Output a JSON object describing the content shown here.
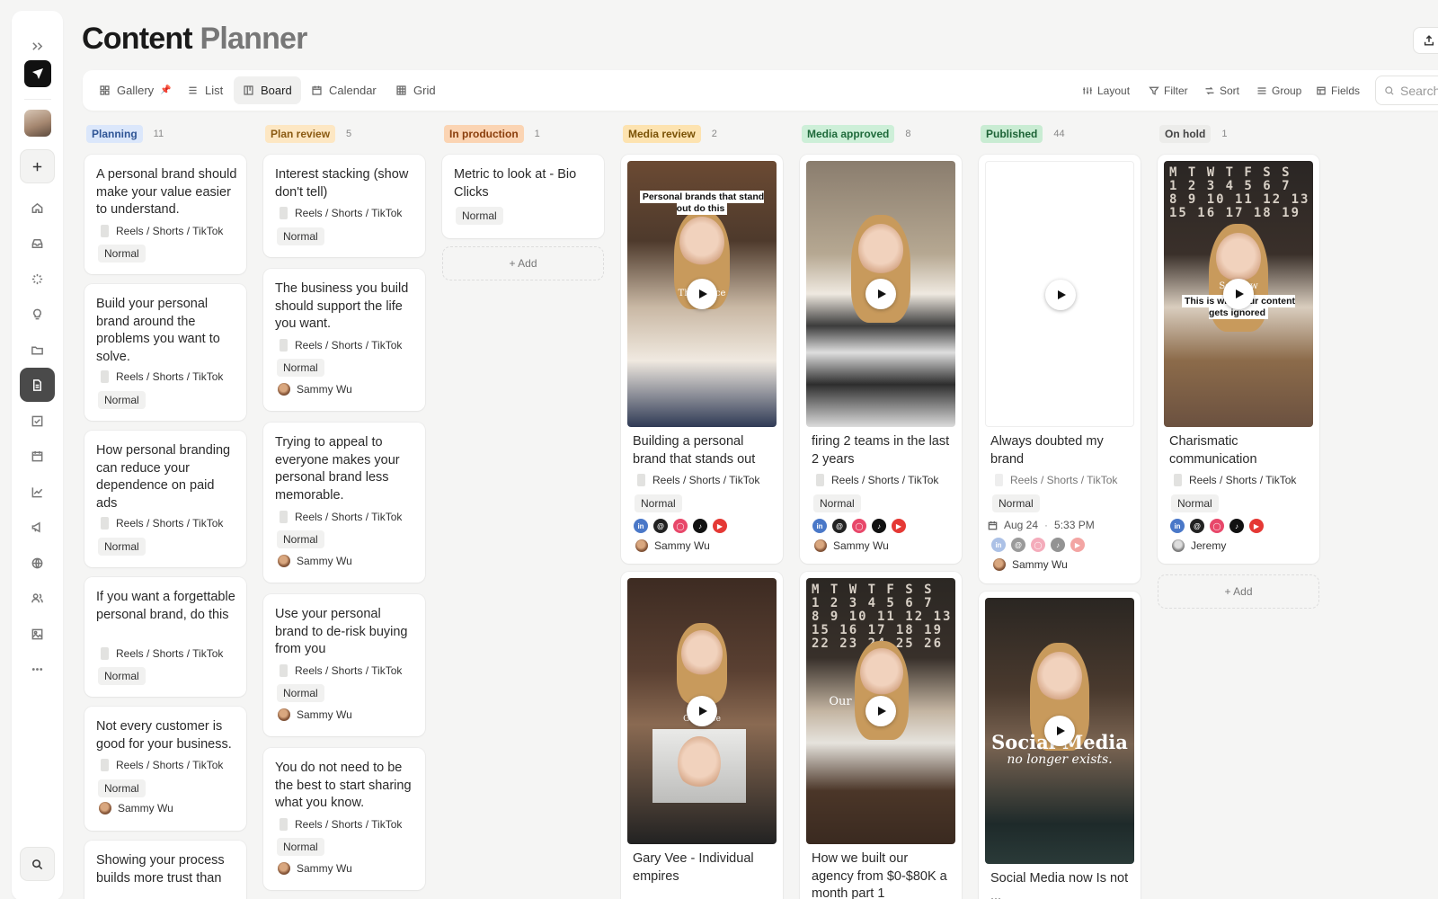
{
  "header": {
    "title_bold": "Content",
    "title_light": "Planner"
  },
  "views": [
    {
      "label": "Gallery",
      "icon": "gallery-icon",
      "pinned": true
    },
    {
      "label": "List",
      "icon": "list-icon"
    },
    {
      "label": "Board",
      "icon": "board-icon",
      "active": true
    },
    {
      "label": "Calendar",
      "icon": "calendar-icon"
    },
    {
      "label": "Grid",
      "icon": "grid-icon"
    }
  ],
  "tools": {
    "layout": "Layout",
    "filter": "Filter",
    "sort": "Sort",
    "group": "Group",
    "fields": "Fields",
    "search_placeholder": "Search"
  },
  "columns": [
    {
      "status": "Planning",
      "count": "11",
      "bg": "#dbe7fb",
      "fg": "#2f5596",
      "cards": [
        {
          "title": "A personal brand should make your value easier to understand.",
          "format": "Reels / Shorts / TikTok",
          "priority": "Normal"
        },
        {
          "title": "Build your personal brand around the problems you want to solve.",
          "format": "Reels / Shorts / TikTok",
          "priority": "Normal"
        },
        {
          "title": "How personal branding can reduce your dependence on paid ads",
          "format": "Reels / Shorts / TikTok",
          "priority": "Normal"
        },
        {
          "title": "If you want a forgettable personal brand, do this",
          "format": "Reels / Shorts / TikTok",
          "priority": "Normal"
        },
        {
          "title": "Not every customer is good for your business.",
          "format": "Reels / Shorts / TikTok",
          "priority": "Normal",
          "assignee": "Sammy Wu"
        },
        {
          "title": "Showing your process builds more trust than"
        }
      ]
    },
    {
      "status": "Plan review",
      "count": "5",
      "bg": "#fde7c3",
      "fg": "#8a5a12",
      "cards": [
        {
          "title": "Interest stacking (show don't tell)",
          "format": "Reels / Shorts / TikTok",
          "priority": "Normal"
        },
        {
          "title": "The business you build should support the life you want.",
          "format": "Reels / Shorts / TikTok",
          "priority": "Normal",
          "assignee": "Sammy Wu"
        },
        {
          "title": "Trying to appeal to everyone makes your personal brand less memorable.",
          "format": "Reels / Shorts / TikTok",
          "priority": "Normal",
          "assignee": "Sammy Wu"
        },
        {
          "title": "Use your personal brand to de-risk buying from you",
          "format": "Reels / Shorts / TikTok",
          "priority": "Normal",
          "assignee": "Sammy Wu"
        },
        {
          "title": "You do not need to be the best to start sharing what you know.",
          "format": "Reels / Shorts / TikTok",
          "priority": "Normal",
          "assignee": "Sammy Wu"
        }
      ]
    },
    {
      "status": "In production",
      "count": "1",
      "bg": "#fbd4b3",
      "fg": "#8a3e0c",
      "cards": [
        {
          "title": "Metric to look at - Bio Clicks",
          "priority": "Normal"
        }
      ],
      "add_label": "+ Add"
    },
    {
      "status": "Media review",
      "count": "2",
      "bg": "#fde3b0",
      "fg": "#7a5206",
      "cards": [
        {
          "title": "Building a personal brand that stands out",
          "format": "Reels / Shorts / TikTok",
          "priority": "Normal",
          "assignee": "Sammy Wu",
          "caption": "Personal brands that stand out do this",
          "overlay": "The ... nce"
        },
        {
          "title": "Gary Vee - Individual empires",
          "overlay": "Gar ... ee"
        }
      ]
    },
    {
      "status": "Media approved",
      "count": "8",
      "bg": "#cdefd8",
      "fg": "#1f6a3b",
      "cards": [
        {
          "title": "firing 2 teams in the last 2 years",
          "format": "Reels / Shorts / TikTok",
          "priority": "Normal",
          "assignee": "Sammy Wu"
        },
        {
          "title": "How we built our agency from $0-$80K a month part 1",
          "overlay": "Our"
        }
      ]
    },
    {
      "status": "Published",
      "count": "44",
      "bg": "#c9ecd3",
      "fg": "#1d6336",
      "cards": [
        {
          "title": "Always doubted my brand",
          "format": "Reels / Shorts / TikTok",
          "priority": "Normal",
          "date": "Aug 24",
          "time": "5:33 PM",
          "assignee": "Sammy Wu"
        },
        {
          "title": "Social Media now Is not ...",
          "overlay_line1": "Social Media",
          "overlay_line2": "no longer exists."
        }
      ]
    },
    {
      "status": "On hold",
      "count": "1",
      "bg": "#ececea",
      "fg": "#444",
      "cards": [
        {
          "title": "Charismatic communication",
          "format": "Reels / Shorts / TikTok",
          "priority": "Normal",
          "assignee": "Jeremy",
          "caption": "This is why your content gets ignored",
          "overlay": "So ... ow"
        }
      ],
      "add_label": "+ Add"
    }
  ],
  "colors": {
    "accent": "#4a4a4a",
    "page_bg": "#f5f5f4"
  },
  "sidebar_icons": [
    "expand-icon",
    "logo-icon",
    "avatar",
    "plus-icon",
    "home-icon",
    "inbox-icon",
    "loader-icon",
    "lightbulb-icon",
    "folder-icon",
    "document-icon",
    "checkbox-icon",
    "calendar-icon",
    "chart-icon",
    "megaphone-icon",
    "globe-icon",
    "people-icon",
    "image-icon",
    "more-icon",
    "search-icon"
  ]
}
